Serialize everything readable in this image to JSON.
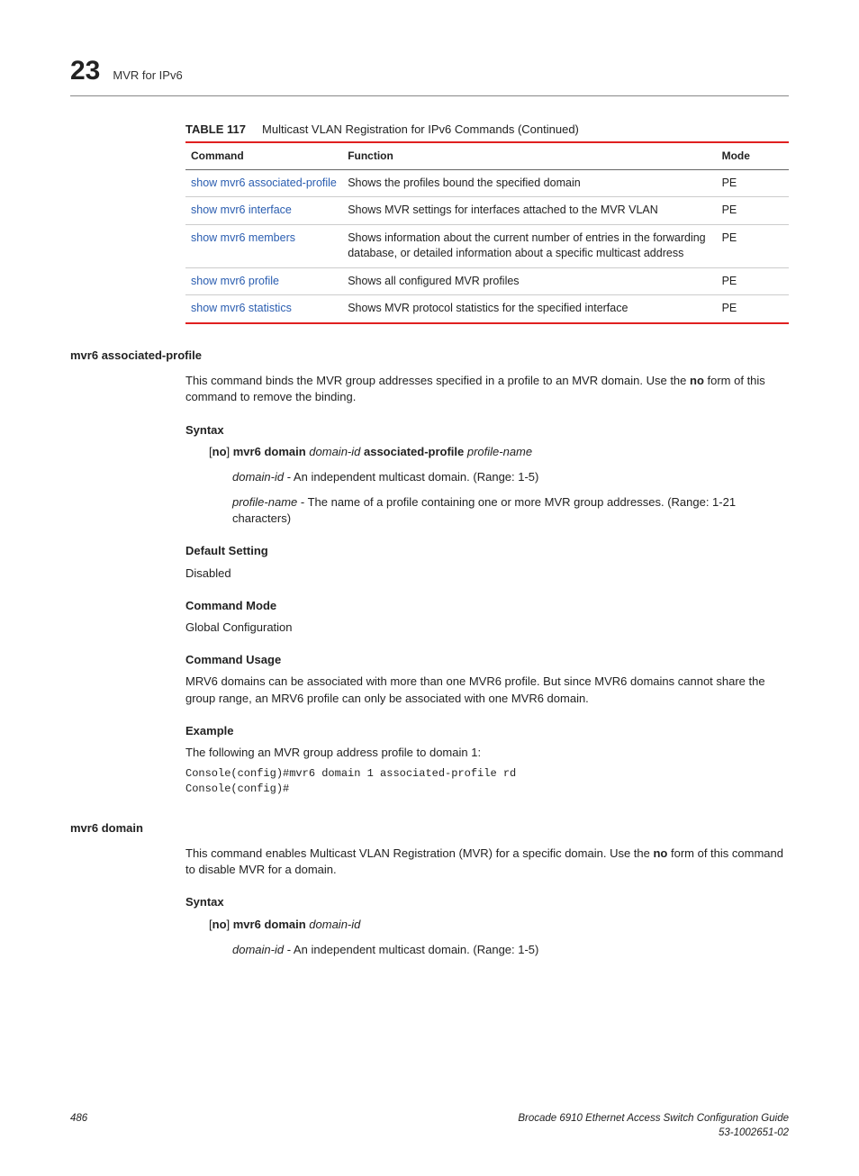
{
  "header": {
    "chapter_number": "23",
    "chapter_title": "MVR for IPv6"
  },
  "table": {
    "label": "TABLE 117",
    "caption": "Multicast VLAN Registration for IPv6 Commands  (Continued)",
    "headers": {
      "command": "Command",
      "function": "Function",
      "mode": "Mode"
    },
    "rows": [
      {
        "command": "show mvr6 associated-profile",
        "function": "Shows the profiles bound the specified domain",
        "mode": "PE"
      },
      {
        "command": "show mvr6 interface",
        "function": "Shows MVR settings for interfaces attached to the MVR VLAN",
        "mode": "PE"
      },
      {
        "command": "show mvr6 members",
        "function": "Shows information about the current number of entries in the forwarding database, or detailed information about a specific multicast address",
        "mode": "PE"
      },
      {
        "command": "show mvr6 profile",
        "function": "Shows all configured MVR profiles",
        "mode": "PE"
      },
      {
        "command": "show mvr6 statistics",
        "function": "Shows MVR protocol statistics for the specified interface",
        "mode": "PE"
      }
    ]
  },
  "sections": {
    "s1": {
      "heading": "mvr6 associated-profile",
      "para_pre": "This command binds the MVR group addresses specified in a profile to an MVR domain. Use the ",
      "para_bold": "no",
      "para_post": " form of this command to remove the binding.",
      "syntax_label": "Syntax",
      "syntax_parts": {
        "lb": "[",
        "no": "no",
        "rb": "] ",
        "mvr6_domain": "mvr6 domain ",
        "domain_id": "domain-id",
        "assoc": " associated-profile ",
        "profile_name": "profile-name"
      },
      "param1_name": "domain-id",
      "param1_text": " - An independent multicast domain. (Range: 1-5)",
      "param2_name": "profile-name",
      "param2_text": " - The name of a profile containing one or more MVR group addresses. (Range: 1-21 characters)",
      "default_label": "Default Setting",
      "default_text": "Disabled",
      "mode_label": "Command Mode",
      "mode_text": "Global Configuration",
      "usage_label": "Command Usage",
      "usage_text": "MRV6 domains can be associated with more than one MVR6 profile. But since MVR6 domains cannot share the group range, an MRV6 profile can only be associated with one MVR6 domain.",
      "example_label": "Example",
      "example_intro": "The following an MVR group address profile to domain 1:",
      "example_code": "Console(config)#mvr6 domain 1 associated-profile rd\nConsole(config)#"
    },
    "s2": {
      "heading": "mvr6 domain",
      "para_pre": "This command enables Multicast VLAN Registration (MVR) for a specific domain. Use the ",
      "para_bold": "no",
      "para_post": " form of this command to disable MVR for a domain.",
      "syntax_label": "Syntax",
      "syntax_parts": {
        "lb": "[",
        "no": "no",
        "rb": "] ",
        "mvr6_domain": "mvr6 domain ",
        "domain_id": "domain-id"
      },
      "param1_name": "domain-id",
      "param1_text": " - An independent multicast domain. (Range: 1-5)"
    }
  },
  "footer": {
    "page": "486",
    "right1": "Brocade 6910 Ethernet Access Switch Configuration Guide",
    "right2": "53-1002651-02"
  }
}
